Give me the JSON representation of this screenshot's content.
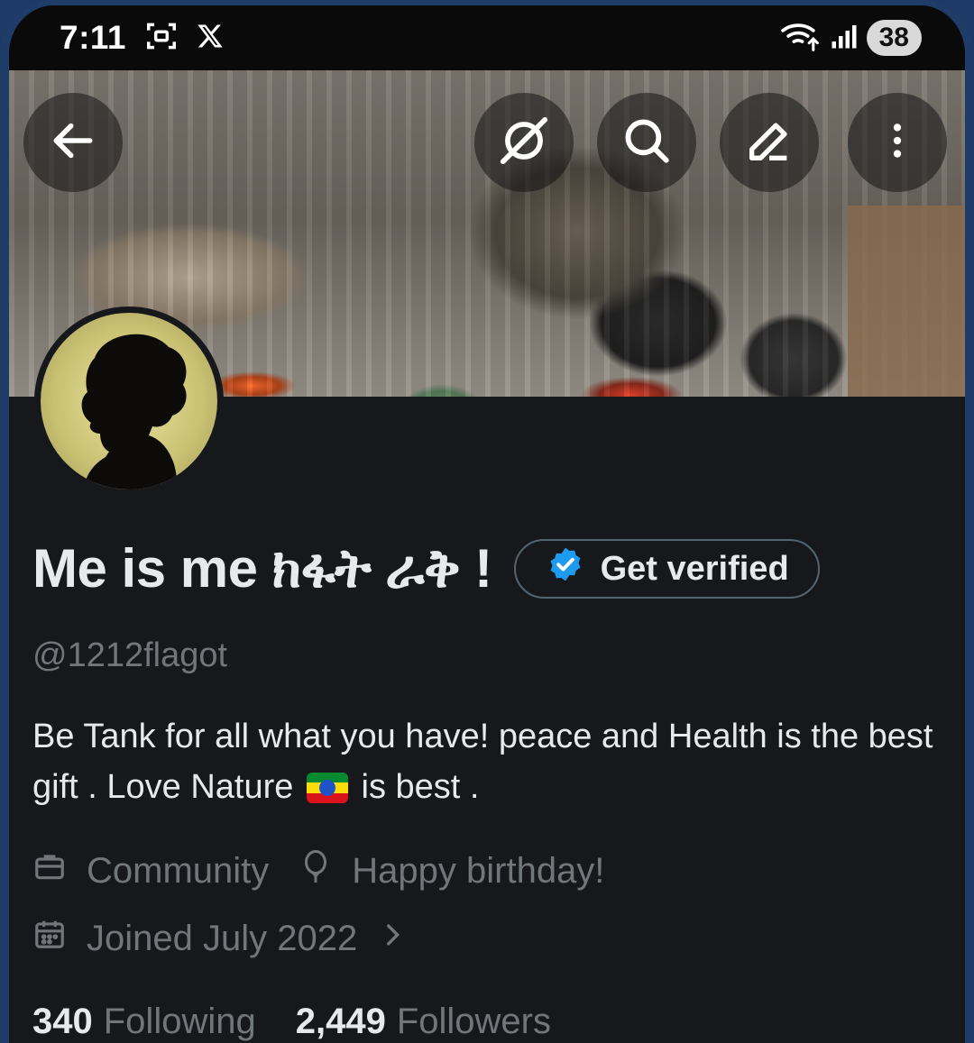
{
  "status_bar": {
    "time": "7:11",
    "battery": "38",
    "icons": [
      "screenshot-icon",
      "x-logo-icon",
      "wifi-icon",
      "signal-icon"
    ]
  },
  "header": {
    "icons": [
      "back-arrow-icon",
      "grok-icon",
      "search-icon",
      "edit-icon",
      "more-vertical-icon"
    ]
  },
  "profile": {
    "display_name": "Me is me ክፋት ራቅ !",
    "verify_label": "Get verified",
    "handle": "@1212flagot",
    "bio_part1": "Be Tank for all what you have! peace and Health is the best gift . Love Nature",
    "bio_part2": "is best .",
    "category": "Community",
    "birthday": "Happy birthday!",
    "joined": "Joined July 2022",
    "following_count": "340",
    "following_label": "Following",
    "followers_count": "2,449",
    "followers_label": "Followers"
  },
  "colors": {
    "background": "#16181c",
    "text_primary": "#e7e9ea",
    "text_secondary": "#71767b",
    "verified_blue": "#1d9bf0"
  }
}
